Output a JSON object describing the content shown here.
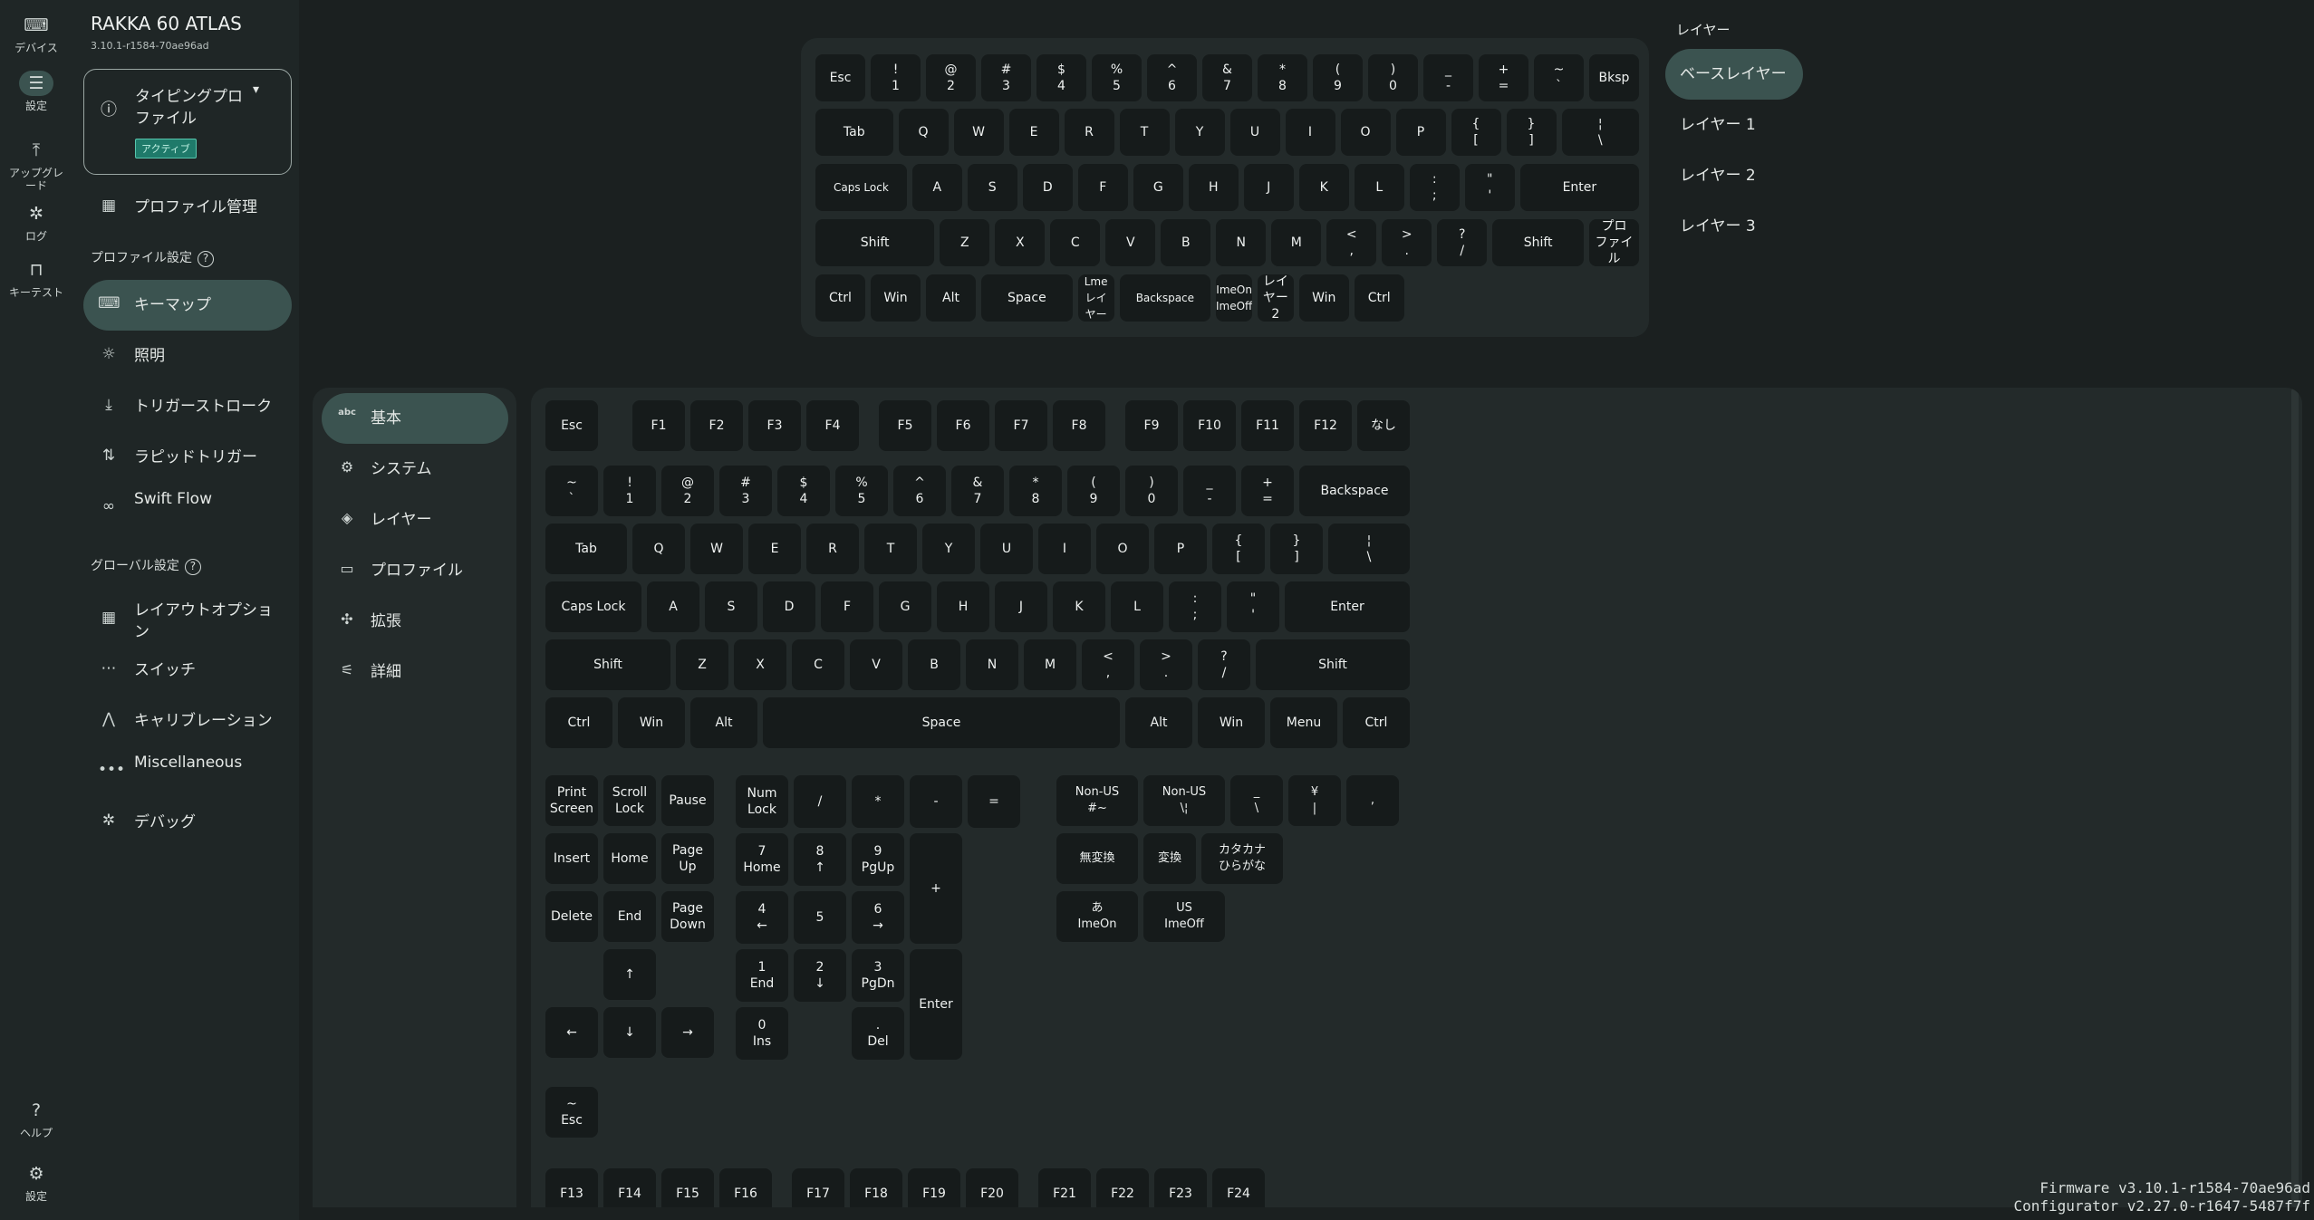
{
  "rail": {
    "items": [
      {
        "label": "デバイス",
        "icon": "keyboard-icon",
        "glyph": "⌨"
      },
      {
        "label": "設定",
        "icon": "sliders-icon",
        "glyph": "☰",
        "active": true
      },
      {
        "label": "アップグレード",
        "icon": "upgrade-icon",
        "glyph": "⤒"
      },
      {
        "label": "ログ",
        "icon": "bug-icon",
        "glyph": "✲"
      },
      {
        "label": "キーテスト",
        "icon": "key-test-icon",
        "glyph": "⊓"
      }
    ],
    "bottom": [
      {
        "label": "ヘルプ",
        "icon": "help-icon",
        "glyph": "?"
      },
      {
        "label": "設定",
        "icon": "gear-icon",
        "glyph": "⚙"
      }
    ]
  },
  "device": {
    "name": "RAKKA 60 ATLAS",
    "version": "3.10.1-r1584-70ae96ad"
  },
  "profile": {
    "name": "タイピングプロファイル",
    "badge": "アクティブ"
  },
  "sidebar": {
    "manage": "プロファイル管理",
    "profile_section": "プロファイル設定",
    "profile_items": [
      {
        "label": "キーマップ",
        "icon": "keymap-icon",
        "glyph": "⌨",
        "active": true
      },
      {
        "label": "照明",
        "icon": "lighting-icon",
        "glyph": "☼"
      },
      {
        "label": "トリガーストローク",
        "icon": "trigger-icon",
        "glyph": "⤓"
      },
      {
        "label": "ラピッドトリガー",
        "icon": "rapid-trigger-icon",
        "glyph": "⇅"
      },
      {
        "label": "Swift Flow",
        "icon": "swift-flow-icon",
        "glyph": "∞"
      }
    ],
    "global_section": "グローバル設定",
    "global_items": [
      {
        "label": "レイアウトオプション",
        "icon": "layout-icon",
        "glyph": "▦"
      },
      {
        "label": "スイッチ",
        "icon": "switch-icon",
        "glyph": "⋯"
      },
      {
        "label": "キャリブレーション",
        "icon": "calibration-icon",
        "glyph": "⋀"
      },
      {
        "label": "Miscellaneous",
        "icon": "more-icon",
        "glyph": "•••"
      },
      {
        "label": "デバッグ",
        "icon": "debug-icon",
        "glyph": "✲"
      }
    ]
  },
  "layers": {
    "title": "レイヤー",
    "items": [
      {
        "label": "ベースレイヤー",
        "active": true
      },
      {
        "label": "レイヤー 1"
      },
      {
        "label": "レイヤー 2"
      },
      {
        "label": "レイヤー 3"
      }
    ]
  },
  "categories": [
    {
      "label": "基本",
      "icon": "abc-icon",
      "glyph": "abc",
      "active": true
    },
    {
      "label": "システム",
      "icon": "gear-icon",
      "glyph": "⚙"
    },
    {
      "label": "レイヤー",
      "icon": "layers-icon",
      "glyph": "◈"
    },
    {
      "label": "プロファイル",
      "icon": "file-icon",
      "glyph": "▭"
    },
    {
      "label": "拡張",
      "icon": "puzzle-icon",
      "glyph": "✣"
    },
    {
      "label": "詳細",
      "icon": "tune-icon",
      "glyph": "⚟"
    }
  ],
  "keyboard_rows": [
    [
      "Esc",
      "!\n1",
      "@\n2",
      "#\n3",
      "$\n4",
      "%\n5",
      "^\n6",
      "&\n7",
      "*\n8",
      "(\n9",
      ")\n0",
      "_\n-",
      "+\n=",
      "~\n`",
      "Bksp"
    ],
    [
      "Tab",
      "Q",
      "W",
      "E",
      "R",
      "T",
      "Y",
      "U",
      "I",
      "O",
      "P",
      "{\n[",
      "}\n]",
      "¦\n\\"
    ],
    [
      "Caps Lock",
      "A",
      "S",
      "D",
      "F",
      "G",
      "H",
      "J",
      "K",
      "L",
      ":\n;",
      "\"\n'",
      "Enter"
    ],
    [
      "Shift",
      "Z",
      "X",
      "C",
      "V",
      "B",
      "N",
      "M",
      "<\n,",
      ">\n.",
      "?\n/",
      "Shift",
      "プロ\nファイル"
    ],
    [
      "Ctrl",
      "Win",
      "Alt",
      "Space",
      "Lme\nレイ\nヤー",
      "Backspace",
      "ImeOn\nImeOff",
      "レイヤー\n2",
      "Win",
      "Ctrl"
    ]
  ],
  "palette": {
    "fn_row": [
      "Esc",
      "F1",
      "F2",
      "F3",
      "F4",
      "F5",
      "F6",
      "F7",
      "F8",
      "F9",
      "F10",
      "F11",
      "F12",
      "なし"
    ],
    "rows": [
      [
        "~\n`",
        "!\n1",
        "@\n2",
        "#\n3",
        "$\n4",
        "%\n5",
        "^\n6",
        "&\n7",
        "*\n8",
        "(\n9",
        ")\n0",
        "_\n-",
        "+\n=",
        "Backspace"
      ],
      [
        "Tab",
        "Q",
        "W",
        "E",
        "R",
        "T",
        "Y",
        "U",
        "I",
        "O",
        "P",
        "{\n[",
        "}\n]",
        "¦\n\\"
      ],
      [
        "Caps Lock",
        "A",
        "S",
        "D",
        "F",
        "G",
        "H",
        "J",
        "K",
        "L",
        ":\n;",
        "\"\n'",
        "Enter"
      ],
      [
        "Shift",
        "Z",
        "X",
        "C",
        "V",
        "B",
        "N",
        "M",
        "<\n,",
        ">\n.",
        "?\n/",
        "Shift"
      ],
      [
        "Ctrl",
        "Win",
        "Alt",
        "Space",
        "Alt",
        "Win",
        "Menu",
        "Ctrl"
      ]
    ],
    "nav": [
      "Print\nScreen",
      "Scroll\nLock",
      "Pause",
      "Insert",
      "Home",
      "Page\nUp",
      "Delete",
      "End",
      "Page\nDown",
      "↑",
      "←",
      "↓",
      "→"
    ],
    "numpad": [
      "Num\nLock",
      "/",
      "*",
      "-",
      "=",
      "7\nHome",
      "8\n↑",
      "9\nPgUp",
      "+",
      "4\n←",
      "5",
      "6\n→",
      "1\nEnd",
      "2\n↓",
      "3\nPgDn",
      "Enter",
      "0\nIns",
      ".\nDel"
    ],
    "intl": [
      "Non-US\n#~",
      "Non-US\n\\¦",
      "_\n\\",
      "¥\n|",
      ",",
      "無変換",
      "変換",
      "カタカナ\nひらがな",
      "あ\nImeOn",
      "US\nImeOff"
    ],
    "extra": [
      "~\nEsc"
    ],
    "f_high": [
      "F13",
      "F14",
      "F15",
      "F16",
      "F17",
      "F18",
      "F19",
      "F20",
      "F21",
      "F22",
      "F23",
      "F24"
    ]
  },
  "footer": {
    "firmware": "Firmware v3.10.1-r1584-70ae96ad",
    "configurator": "Configurator v2.27.0-r1647-5487f7f"
  }
}
